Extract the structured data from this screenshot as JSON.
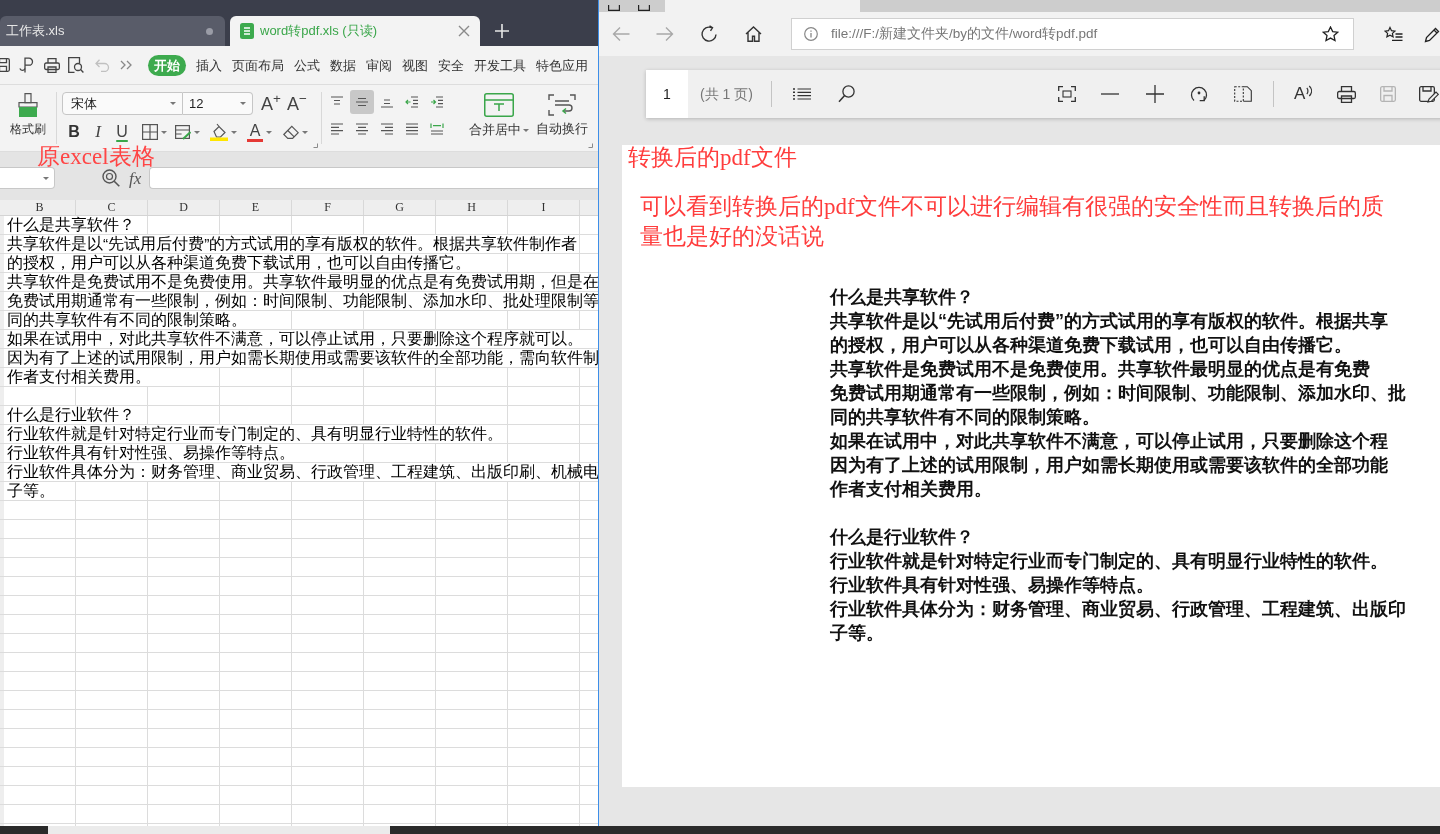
{
  "spreadsheet": {
    "tabs": [
      {
        "label": "工作表.xls",
        "selected": false
      },
      {
        "label": "word转pdf.xls (只读)",
        "selected": true
      }
    ],
    "quick_access": {
      "undo": {
        "disabled": true
      }
    },
    "menu": [
      {
        "label": "开始",
        "selected": true
      },
      {
        "label": "插入",
        "selected": false
      },
      {
        "label": "页面布局",
        "selected": false
      },
      {
        "label": "公式",
        "selected": false
      },
      {
        "label": "数据",
        "selected": false
      },
      {
        "label": "审阅",
        "selected": false
      },
      {
        "label": "视图",
        "selected": false
      },
      {
        "label": "安全",
        "selected": false
      },
      {
        "label": "开发工具",
        "selected": false
      },
      {
        "label": "特色应用",
        "selected": false
      }
    ],
    "ribbon": {
      "format_painter": "格式刷",
      "font_name": "宋体",
      "font_size": "12",
      "grow_font": "A$^{+}$",
      "shrink_font": "A$^{−}$",
      "text_styles": [
        {
          "kind": "bold",
          "label": "B"
        },
        {
          "kind": "italic",
          "label": "I"
        },
        {
          "kind": "underline",
          "label": "U"
        }
      ],
      "font_color": "A",
      "alignments": [
        {
          "kind": "top",
          "selected": false
        },
        {
          "kind": "middle",
          "selected": true
        },
        {
          "kind": "bottom",
          "selected": false
        },
        {
          "kind": "left",
          "selected": false
        },
        {
          "kind": "center",
          "selected": false
        },
        {
          "kind": "right",
          "selected": false
        },
        {
          "kind": "justify",
          "selected": false
        },
        {
          "kind": "distributed",
          "selected": false
        }
      ],
      "merge": "合并居中",
      "wrap": "自动换行"
    },
    "annotation": "原excel表格",
    "formula_bar": {
      "function_label": "fx"
    },
    "columns": [
      "B",
      "C",
      "D",
      "E",
      "F",
      "G",
      "H",
      "I"
    ],
    "sections": [
      {
        "lines": [
          "什么是共享软件？",
          "共享软件是以“先试用后付费”的方式试用的享有版权的软件。根据共享软件制作者",
          "的授权，用户可以从各种渠道免费下载试用，也可以自由传播它。",
          "共享软件是免费试用不是免费使用。共享软件最明显的优点是有免费试用期，但是在",
          "免费试用期通常有一些限制，例如：时间限制、功能限制、添加水印、批处理限制等",
          "同的共享软件有不同的限制策略。",
          "如果在试用中，对此共享软件不满意，可以停止试用，只要删除这个程序就可以。",
          "因为有了上述的试用限制，用户如需长期使用或需要该软件的全部功能，需向软件制",
          "作者支付相关费用。"
        ]
      },
      {
        "lines": [
          "什么是行业软件？",
          "行业软件就是针对特定行业而专门制定的、具有明显行业特性的软件。",
          "行业软件具有针对性强、易操作等特点。",
          "行业软件具体分为：财务管理、商业贸易、行政管理、工程建筑、出版印刷、机械电",
          "子等。"
        ]
      }
    ]
  },
  "browser": {
    "back": {
      "disabled": true
    },
    "forward": {
      "disabled": true
    },
    "address": "file:///F:/新建文件夹/by的文件/word转pdf.pdf",
    "pdf_toolbar": {
      "page": "1",
      "page_count": "(共 1 页)",
      "read_aloud": "A",
      "save": {
        "disabled": true
      }
    },
    "annotation_title": "转换后的pdf文件",
    "annotation_note": "可以看到转换后的pdf文件不可以进行编辑有很强的安全性而且转换后的质量也是好的没话说",
    "sections": [
      {
        "lines": [
          "什么是共享软件？",
          "共享软件是以“先试用后付费”的方式试用的享有版权的软件。根据共享",
          "的授权，用户可以从各种渠道免费下载试用，也可以自由传播它。",
          "共享软件是免费试用不是免费使用。共享软件最明显的优点是有免费",
          "免费试用期通常有一些限制，例如：时间限制、功能限制、添加水印、批",
          "同的共享软件有不同的限制策略。",
          "如果在试用中，对此共享软件不满意，可以停止试用，只要删除这个程",
          "因为有了上述的试用限制，用户如需长期使用或需要该软件的全部功能",
          "作者支付相关费用。"
        ]
      },
      {
        "lines": [
          "什么是行业软件？",
          "行业软件就是针对特定行业而专门制定的、具有明显行业特性的软件。",
          "行业软件具有针对性强、易操作等特点。",
          "行业软件具体分为：财务管理、商业贸易、行政管理、工程建筑、出版印",
          "子等。"
        ]
      }
    ]
  }
}
